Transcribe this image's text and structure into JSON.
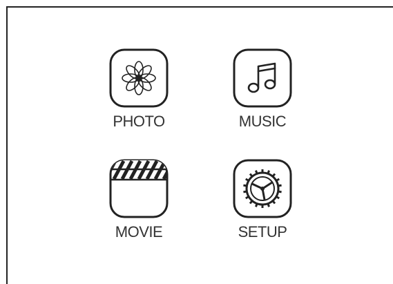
{
  "menu": {
    "items": [
      {
        "label": "PHOTO",
        "icon": "flower-icon"
      },
      {
        "label": "MUSIC",
        "icon": "music-note-icon"
      },
      {
        "label": "MOVIE",
        "icon": "clapperboard-icon"
      },
      {
        "label": "SETUP",
        "icon": "gear-icon"
      }
    ]
  },
  "colors": {
    "stroke": "#222222",
    "text": "#333333",
    "background": "#ffffff"
  }
}
